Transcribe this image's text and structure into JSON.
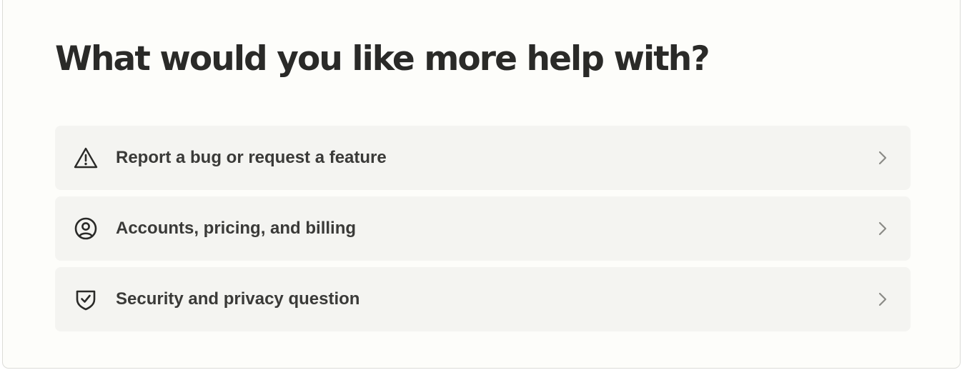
{
  "heading": "What would you like more help with?",
  "options": [
    {
      "icon": "warning-triangle-icon",
      "label": "Report a bug or request a feature"
    },
    {
      "icon": "user-circle-icon",
      "label": "Accounts, pricing, and billing"
    },
    {
      "icon": "shield-check-icon",
      "label": "Security and privacy question"
    }
  ],
  "colors": {
    "card_background": "#fdfdfa",
    "option_background": "#f4f4f1",
    "heading_text": "#2a2a28",
    "option_text": "#3a3a38",
    "chevron": "#8a8a86"
  }
}
